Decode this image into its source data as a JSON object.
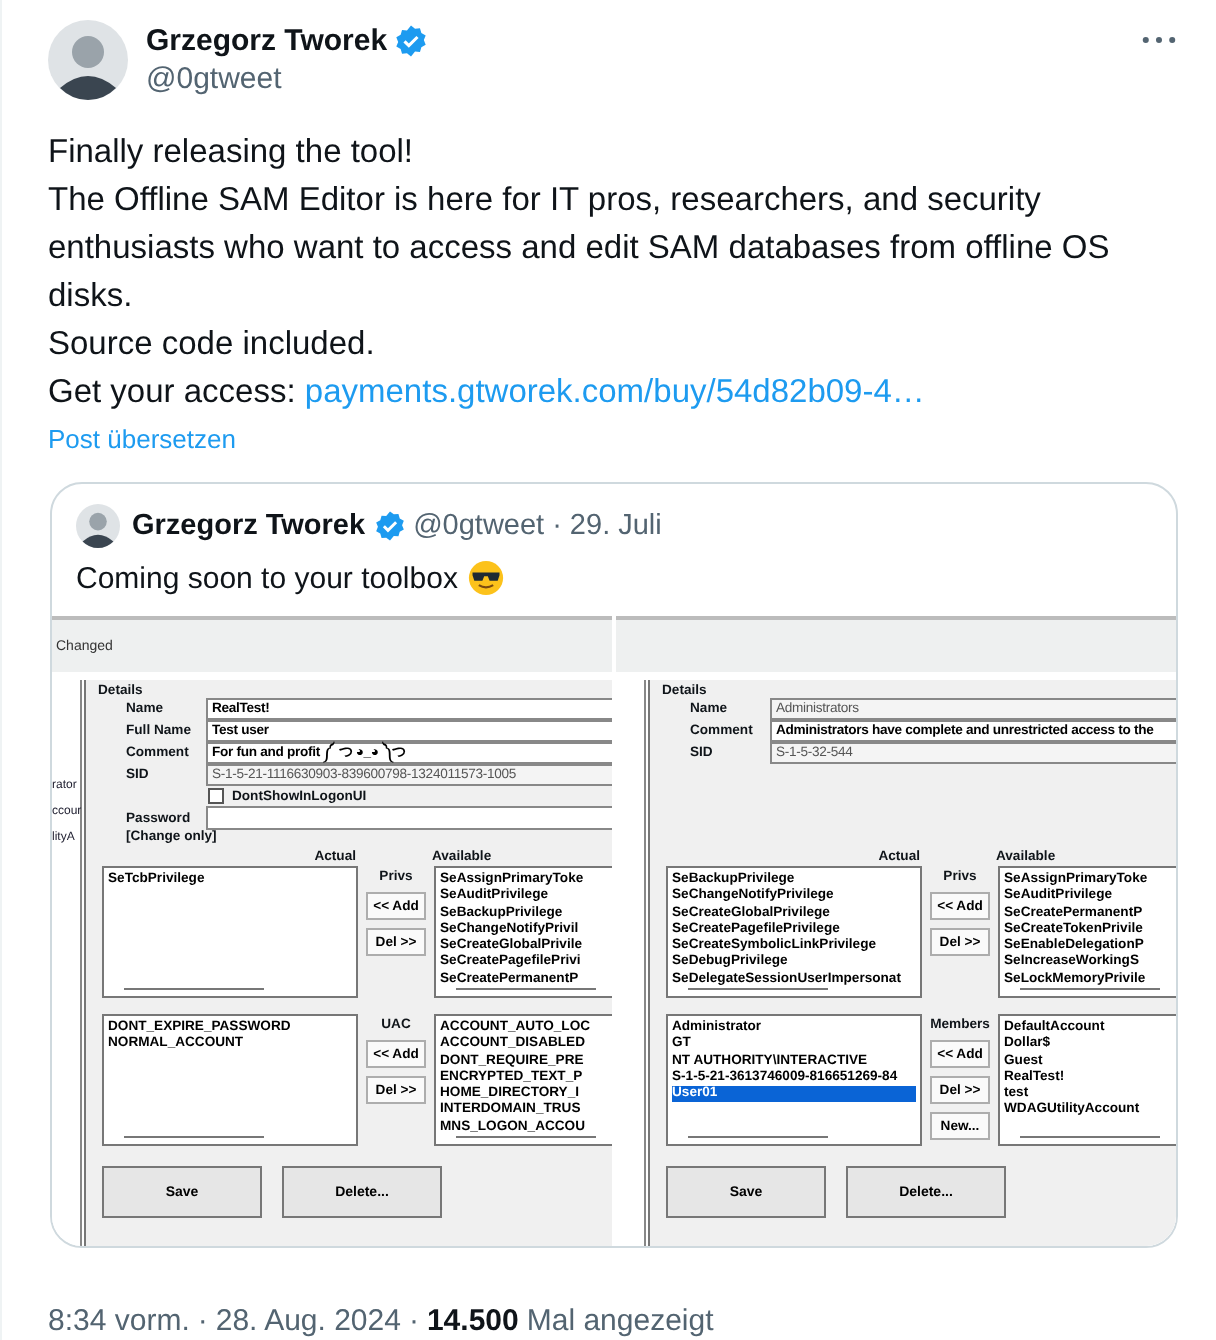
{
  "author": {
    "name": "Grzegorz Tworek",
    "handle": "@0gtweet"
  },
  "text": [
    "Finally releasing the tool!",
    "The Offline SAM Editor is here for IT pros, researchers, and security enthusiasts who want to access and edit SAM databases from offline OS disks.",
    "Source code included."
  ],
  "access": {
    "label": "Get your access:",
    "link": "payments.gtworek.com/buy/54d82b09-4…"
  },
  "translate": "Post übersetzen",
  "quote": {
    "name": "Grzegorz Tworek",
    "handle": "@0gtweet",
    "date": "· 29. Juli",
    "text": "Coming soon to your toolbox",
    "panels": [
      {
        "header": "Changed",
        "fragments": [
          "rator",
          "ccour",
          "lityA"
        ],
        "group": "Details",
        "fields": [
          {
            "label": "Name",
            "value": "RealTest!",
            "kind": "input"
          },
          {
            "label": "Full Name",
            "value": "Test user",
            "kind": "input"
          },
          {
            "label": "Comment",
            "value": "For fun and profit ༼ つ ◕_◕ ༽つ",
            "kind": "input"
          },
          {
            "label": "SID",
            "value": "S-1-5-21-1116630903-839600798-1324011573-1005",
            "kind": "readonly"
          }
        ],
        "checkbox": {
          "label": "DontShowInLogonUI",
          "checked": false
        },
        "password": {
          "label": "Password",
          "note": "[Change only]"
        },
        "lists": [
          {
            "label": "Privs",
            "actual_label": "Actual",
            "available_label": "Available",
            "buttons": [
              "<< Add",
              "Del >>"
            ],
            "actual": [
              {
                "text": "SeTcbPrivilege",
                "selected": false
              }
            ],
            "available": [
              {
                "text": "SeAssignPrimaryToke",
                "selected": false
              },
              {
                "text": "SeAuditPrivilege",
                "selected": false
              },
              {
                "text": "SeBackupPrivilege",
                "selected": false
              },
              {
                "text": "SeChangeNotifyPrivil",
                "selected": false
              },
              {
                "text": "SeCreateGlobalPrivile",
                "selected": false
              },
              {
                "text": "SeCreatePagefilePrivi",
                "selected": false
              },
              {
                "text": "SeCreatePermanentP",
                "selected": false
              }
            ]
          },
          {
            "label": "UAC",
            "buttons": [
              "<< Add",
              "Del >>"
            ],
            "actual": [
              {
                "text": "DONT_EXPIRE_PASSWORD",
                "selected": false
              },
              {
                "text": "NORMAL_ACCOUNT",
                "selected": false
              }
            ],
            "available": [
              {
                "text": "ACCOUNT_AUTO_LOC",
                "selected": false
              },
              {
                "text": "ACCOUNT_DISABLED",
                "selected": false
              },
              {
                "text": "DONT_REQUIRE_PRE",
                "selected": false
              },
              {
                "text": "ENCRYPTED_TEXT_P",
                "selected": false
              },
              {
                "text": "HOME_DIRECTORY_I",
                "selected": false
              },
              {
                "text": "INTERDOMAIN_TRUS",
                "selected": false
              },
              {
                "text": "MNS_LOGON_ACCOU",
                "selected": false
              }
            ]
          }
        ],
        "actions": [
          "Save",
          "Delete..."
        ]
      },
      {
        "group": "Details",
        "fields": [
          {
            "label": "Name",
            "value": "Administrators",
            "kind": "readonly"
          },
          {
            "label": "Comment",
            "value": "Administrators have complete and unrestricted access to the",
            "kind": "input"
          },
          {
            "label": "SID",
            "value": "S-1-5-32-544",
            "kind": "readonly"
          }
        ],
        "lists": [
          {
            "label": "Privs",
            "actual_label": "Actual",
            "available_label": "Available",
            "buttons": [
              "<< Add",
              "Del >>"
            ],
            "actual": [
              {
                "text": "SeBackupPrivilege",
                "selected": false
              },
              {
                "text": "SeChangeNotifyPrivilege",
                "selected": false
              },
              {
                "text": "SeCreateGlobalPrivilege",
                "selected": false
              },
              {
                "text": "SeCreatePagefilePrivilege",
                "selected": false
              },
              {
                "text": "SeCreateSymbolicLinkPrivilege",
                "selected": false
              },
              {
                "text": "SeDebugPrivilege",
                "selected": false
              },
              {
                "text": "SeDelegateSessionUserImpersonat",
                "selected": false
              }
            ],
            "available": [
              {
                "text": "SeAssignPrimaryToke",
                "selected": false
              },
              {
                "text": "SeAuditPrivilege",
                "selected": false
              },
              {
                "text": "SeCreatePermanentP",
                "selected": false
              },
              {
                "text": "SeCreateTokenPrivile",
                "selected": false
              },
              {
                "text": "SeEnableDelegationP",
                "selected": false
              },
              {
                "text": "SeIncreaseWorkingS",
                "selected": false
              },
              {
                "text": "SeLockMemoryPrivile",
                "selected": false
              }
            ]
          },
          {
            "label": "Members",
            "buttons": [
              "<< Add",
              "Del >>",
              "New..."
            ],
            "actual": [
              {
                "text": "Administrator",
                "selected": false
              },
              {
                "text": "GT",
                "selected": false
              },
              {
                "text": "NT AUTHORITY\\INTERACTIVE",
                "selected": false
              },
              {
                "text": "S-1-5-21-3613746009-816651269-84",
                "selected": false
              },
              {
                "text": "User01",
                "selected": true
              }
            ],
            "available": [
              {
                "text": "DefaultAccount",
                "selected": false
              },
              {
                "text": "Dollar$",
                "selected": false
              },
              {
                "text": "Guest",
                "selected": false
              },
              {
                "text": "RealTest!",
                "selected": false
              },
              {
                "text": "test",
                "selected": false
              },
              {
                "text": "WDAGUtilityAccount",
                "selected": false
              }
            ]
          }
        ],
        "actions": [
          "Save",
          "Delete..."
        ]
      }
    ]
  },
  "footer": {
    "time": "8:34 vorm.",
    "separators": [
      "·",
      "·"
    ],
    "date": "28. Aug. 2024",
    "views": "14.500",
    "views_label": "Mal angezeigt"
  }
}
